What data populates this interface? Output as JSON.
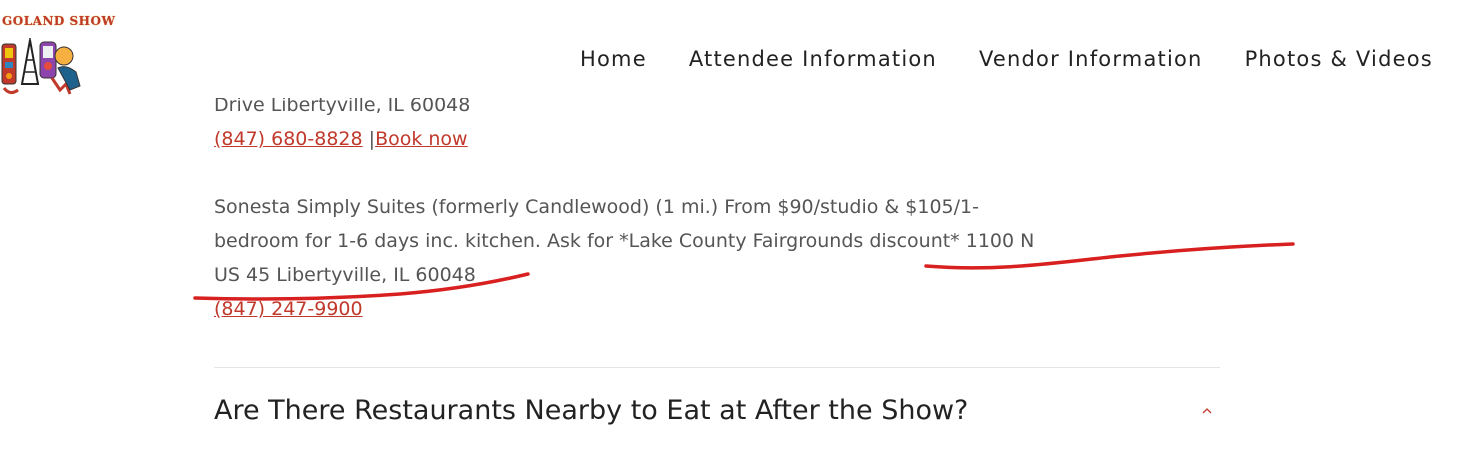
{
  "logo": {
    "text": "GOLAND SHOW"
  },
  "nav": {
    "items": [
      "Home",
      "Attendee Information",
      "Vendor Information",
      "Photos & Videos"
    ]
  },
  "content": {
    "partial_line": "Drive Libertyville, IL 60048",
    "hotel1_phone": "(847) 680-8828",
    "hotel1_separator": "|",
    "hotel1_book": "Book now",
    "hotel2_line1": "Sonesta Simply Suites (formerly Candlewood) (1 mi.) From $90/studio & $105/1-",
    "hotel2_line2": "bedroom for 1-6 days inc. kitchen. Ask for *Lake County Fairgrounds discount* 1100 N",
    "hotel2_line3": "US 45 Libertyville, IL 60048",
    "hotel2_phone": "(847) 247-9900"
  },
  "faq": {
    "title": "Are There Restaurants Nearby to Eat at After the Show?"
  },
  "colors": {
    "link": "#c0392b",
    "annotation": "#d92020",
    "text": "#555555",
    "heading": "#222222"
  }
}
